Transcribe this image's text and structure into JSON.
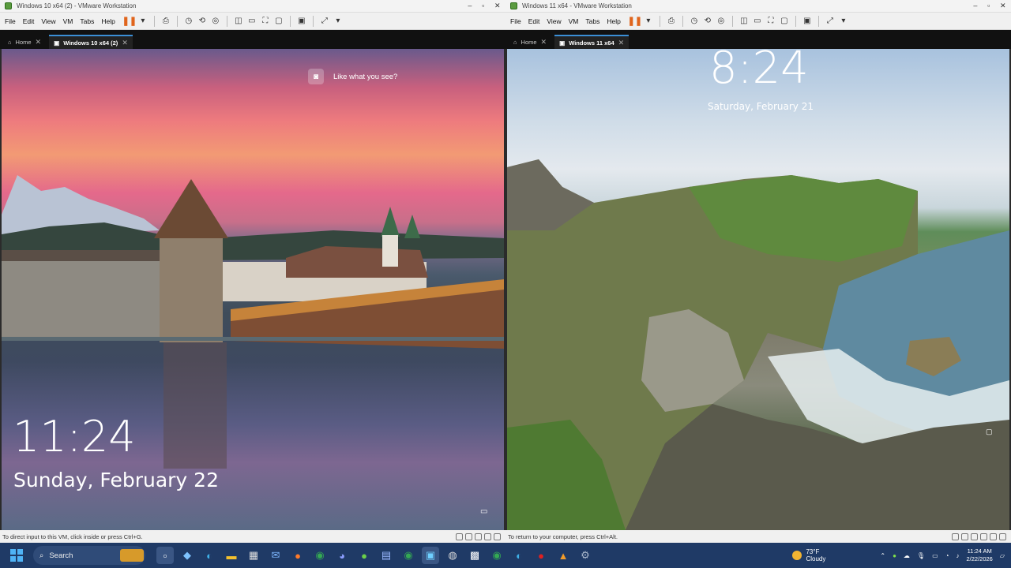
{
  "left_window": {
    "title": "Windows 10 x64 (2) - VMware Workstation",
    "menu": [
      "File",
      "Edit",
      "View",
      "VM",
      "Tabs",
      "Help"
    ],
    "tabs": [
      {
        "label": "Home"
      },
      {
        "label": "Windows 10 x64 (2)"
      }
    ],
    "lock_time": "11:24",
    "lock_date": "Sunday, February 22",
    "spotlight_text": "Like what you see?",
    "status_text": "To direct input to this VM, click inside or press Ctrl+G."
  },
  "right_window": {
    "title": "Windows 11 x64 - VMware Workstation",
    "menu": [
      "File",
      "Edit",
      "View",
      "VM",
      "Tabs",
      "Help"
    ],
    "tabs": [
      {
        "label": "Home"
      },
      {
        "label": "Windows 11 x64"
      }
    ],
    "lock_time": "8:24",
    "lock_date": "Saturday, February 21",
    "status_text": "To return to your computer, press Ctrl+Alt."
  },
  "taskbar": {
    "search_placeholder": "Search",
    "weather_temp": "73°F",
    "weather_desc": "Cloudy",
    "time": "11:24 AM",
    "date": "2/22/2026"
  },
  "colors": {
    "taskbar_bg": "#1f3a66",
    "pause_accent": "#e0641c",
    "tab_accent": "#3b8fd6"
  }
}
